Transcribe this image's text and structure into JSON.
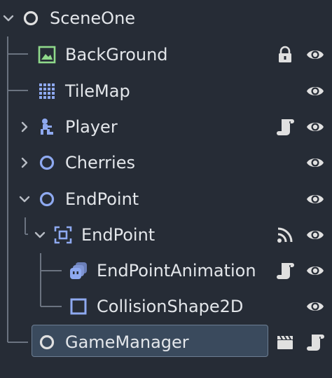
{
  "tree": {
    "root": {
      "label": "SceneOne",
      "icon": "node-icon",
      "expanded": true
    },
    "nodes": [
      {
        "label": "BackGround",
        "icon": "image-icon",
        "badges": [
          "lock-icon",
          "eye-icon"
        ]
      },
      {
        "label": "TileMap",
        "icon": "tilemap-icon",
        "badges": [
          "eye-icon"
        ]
      },
      {
        "label": "Player",
        "icon": "character-icon",
        "expanded": false,
        "badges": [
          "script-icon",
          "eye-icon"
        ]
      },
      {
        "label": "Cherries",
        "icon": "node-icon",
        "expanded": false,
        "badges": [
          "eye-icon"
        ]
      },
      {
        "label": "EndPoint",
        "icon": "node-icon",
        "expanded": true,
        "badges": [
          "eye-icon"
        ]
      },
      {
        "label": "EndPoint",
        "icon": "area-icon",
        "expanded": true,
        "badges": [
          "signal-icon",
          "eye-icon"
        ]
      },
      {
        "label": "EndPointAnimation",
        "icon": "animated-sprite-icon",
        "badges": [
          "script-icon",
          "eye-icon"
        ]
      },
      {
        "label": "CollisionShape2D",
        "icon": "collision-shape-icon",
        "badges": [
          "eye-icon"
        ]
      },
      {
        "label": "GameManager",
        "icon": "node-icon",
        "selected": true,
        "badges": [
          "clapperboard-icon",
          "script-icon"
        ]
      }
    ]
  },
  "colors": {
    "background": "#262c36",
    "text": "#e3e6ea",
    "node_blue": "#8ea9f0",
    "image_green": "#8fd98b",
    "selection": "#3a4a5d",
    "icon_gray": "#e0e0e0"
  }
}
